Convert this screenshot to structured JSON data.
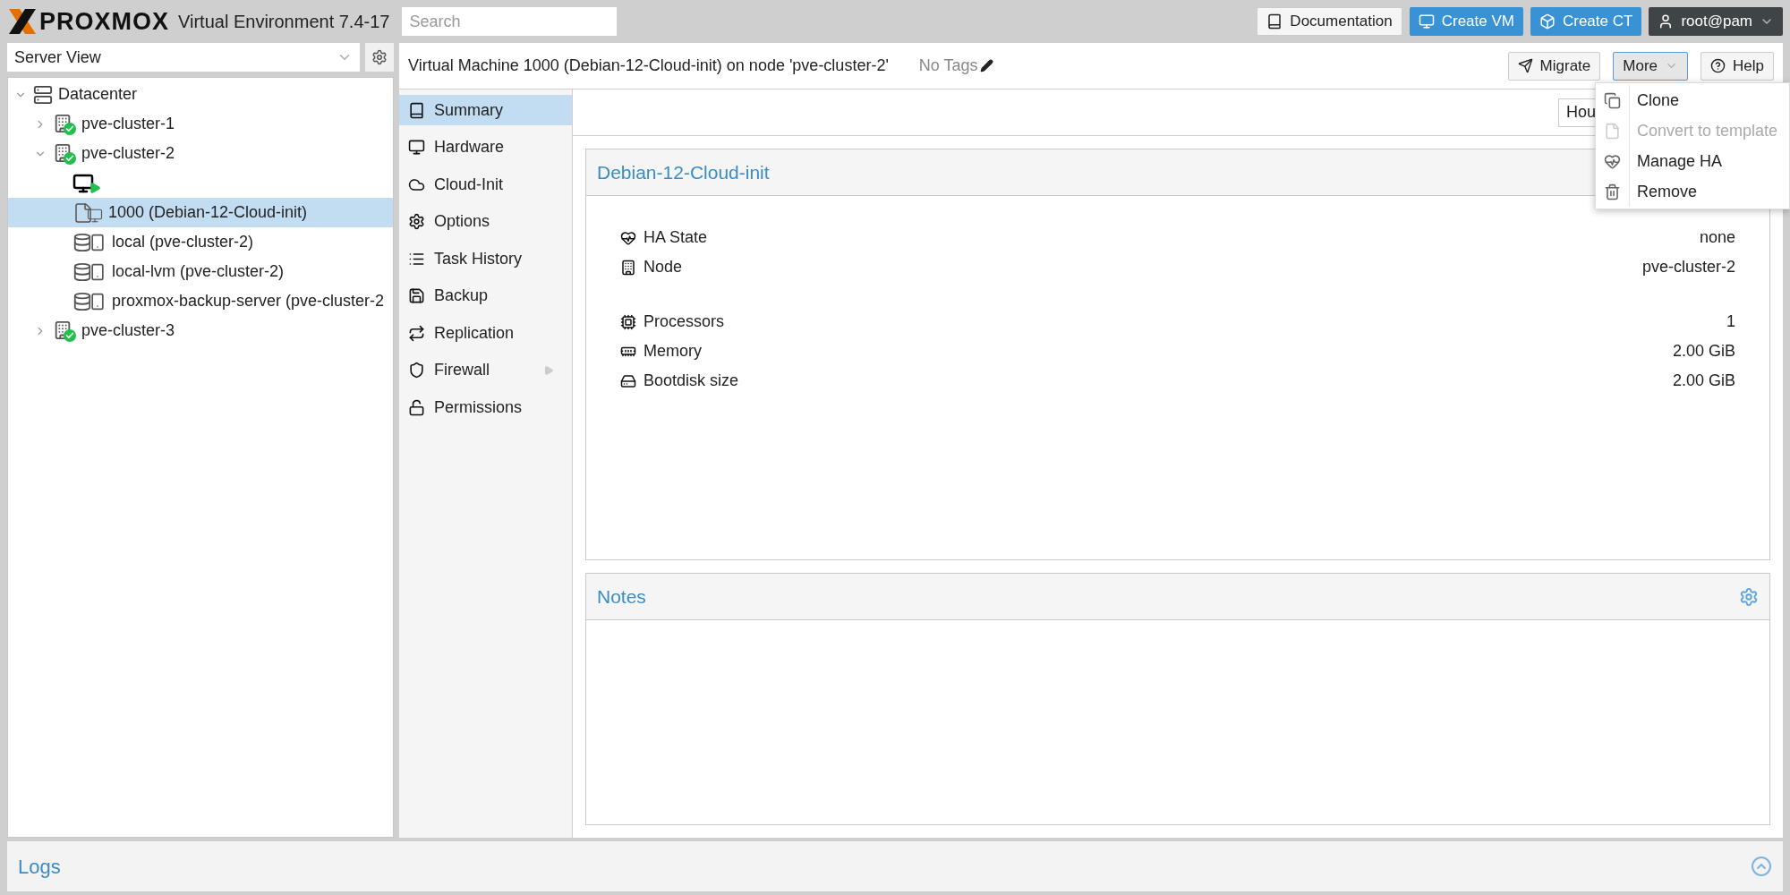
{
  "header": {
    "logo": "PROXMOX",
    "product": "Virtual Environment 7.4-17",
    "search": {
      "placeholder": "Search"
    },
    "buttons": [
      {
        "kind": "docs",
        "label": "Documentation"
      },
      {
        "kind": "create-vm",
        "label": "Create VM"
      },
      {
        "kind": "create-ct",
        "label": "Create CT"
      },
      {
        "kind": "user",
        "label": "root@pam"
      }
    ]
  },
  "sidebar": {
    "view_select": {
      "value": "Server View"
    },
    "tree": [
      {
        "kind": "datacenter",
        "label": "Datacenter",
        "expanded": true,
        "selected": false,
        "children": [
          {
            "kind": "node",
            "label": "pve-cluster-1",
            "expanded": false,
            "selected": false
          },
          {
            "kind": "node",
            "label": "pve-cluster-2",
            "expanded": true,
            "selected": false,
            "children": [
              {
                "kind": "vm-running",
                "selected": false
              },
              {
                "kind": "template",
                "label": "1000 (Debian-12-Cloud-init)",
                "selected": true
              },
              {
                "kind": "storage",
                "label": "local (pve-cluster-2)",
                "selected": false
              },
              {
                "kind": "storage",
                "label": "local-lvm (pve-cluster-2)",
                "selected": false
              },
              {
                "kind": "storage",
                "label": "proxmox-backup-server (pve-cluster-2",
                "selected": false
              }
            ]
          },
          {
            "kind": "node",
            "label": "pve-cluster-3",
            "expanded": false,
            "selected": false
          }
        ]
      }
    ]
  },
  "content": {
    "title": "Virtual Machine 1000 (Debian-12-Cloud-init) on node 'pve-cluster-2'",
    "tags": "No Tags",
    "toolbar": [
      {
        "kind": "migrate",
        "label": "Migrate"
      },
      {
        "kind": "more",
        "label": "More",
        "open": true
      },
      {
        "kind": "help",
        "label": "Help"
      }
    ],
    "more_menu": [
      {
        "kind": "clone",
        "label": "Clone",
        "disabled": false
      },
      {
        "kind": "template",
        "label": "Convert to template",
        "disabled": true
      },
      {
        "kind": "ha",
        "label": "Manage HA",
        "disabled": false
      },
      {
        "kind": "remove",
        "label": "Remove",
        "disabled": false
      }
    ],
    "nav": [
      {
        "kind": "summary",
        "label": "Summary",
        "selected": true
      },
      {
        "kind": "hardware",
        "label": "Hardware",
        "selected": false
      },
      {
        "kind": "cloud",
        "label": "Cloud-Init",
        "selected": false
      },
      {
        "kind": "options",
        "label": "Options",
        "selected": false
      },
      {
        "kind": "tasks",
        "label": "Task History",
        "selected": false
      },
      {
        "kind": "backup",
        "label": "Backup",
        "selected": false
      },
      {
        "kind": "replication",
        "label": "Replication",
        "selected": false
      },
      {
        "kind": "firewall",
        "label": "Firewall",
        "selected": false,
        "submenu": true
      },
      {
        "kind": "permissions",
        "label": "Permissions",
        "selected": false
      }
    ],
    "timeframe": {
      "value": "Hou"
    },
    "status_panel": {
      "title": "Debian-12-Cloud-init",
      "groups": [
        [
          {
            "kind": "ha",
            "label": "HA State",
            "value": "none"
          },
          {
            "kind": "node",
            "label": "Node",
            "value": "pve-cluster-2"
          }
        ],
        [
          {
            "kind": "cpu",
            "label": "Processors",
            "value": "1"
          },
          {
            "kind": "memory",
            "label": "Memory",
            "value": "2.00 GiB"
          },
          {
            "kind": "disk",
            "label": "Bootdisk size",
            "value": "2.00 GiB"
          }
        ]
      ]
    },
    "notes_panel": {
      "title": "Notes"
    }
  },
  "logs": {
    "title": "Logs"
  }
}
